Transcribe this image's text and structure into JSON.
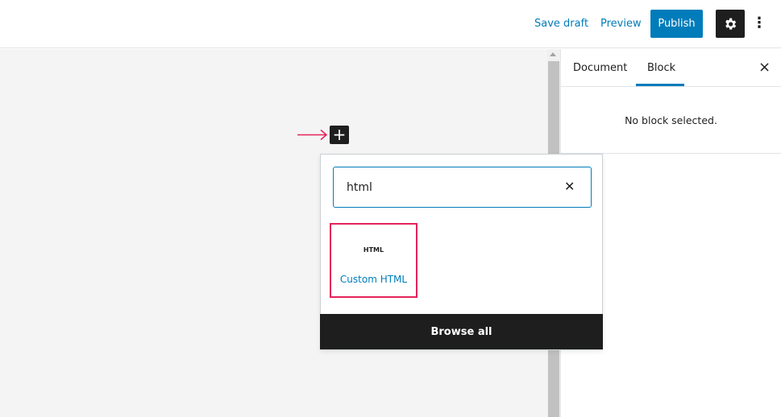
{
  "header": {
    "save_draft": "Save draft",
    "preview": "Preview",
    "publish": "Publish",
    "settings_icon": "gear-icon",
    "more_icon": "more-vertical-icon",
    "more_glyph": "⋮"
  },
  "sidebar": {
    "tabs": [
      "Document",
      "Block"
    ],
    "active_tab": "Block",
    "close": "×",
    "empty_message": "No block selected."
  },
  "inserter": {
    "plus": "+",
    "search_value": "html",
    "clear": "✕",
    "results": [
      {
        "icon_text": "HTML",
        "label": "Custom HTML"
      }
    ],
    "browse_all": "Browse all"
  },
  "colors": {
    "accent": "#007cba",
    "highlight": "#e4245a",
    "dark": "#1e1e1e"
  }
}
